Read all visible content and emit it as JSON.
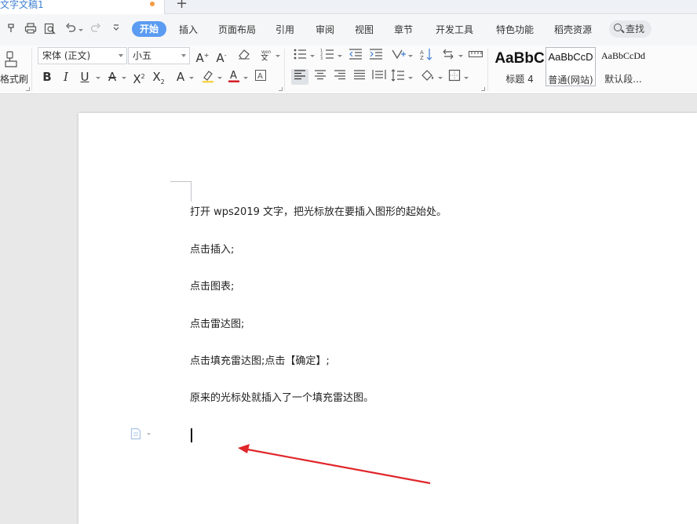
{
  "tab": {
    "title": "文字文稿1"
  },
  "menu": {
    "items": [
      "开始",
      "插入",
      "页面布局",
      "引用",
      "审阅",
      "视图",
      "章节",
      "开发工具",
      "特色功能",
      "稻壳资源"
    ],
    "active": "开始",
    "search_label": "查找"
  },
  "ribbon": {
    "format_painter_label": "格式刷",
    "font_name": "宋体 (正文)",
    "font_size": "小五",
    "styles": [
      {
        "sample": "AaBbC",
        "name": "标题 4"
      },
      {
        "sample": "AaBbCcD",
        "name": "普通(网站)"
      },
      {
        "sample": "AaBbCcDd",
        "name": "默认段..."
      }
    ]
  },
  "document": {
    "paragraphs": [
      "打开 wps2019 文字，把光标放在要插入图形的起始处。",
      "点击插入;",
      "点击图表;",
      "点击雷达图;",
      "点击填充雷达图;点击【确定】;",
      "原来的光标处就插入了一个填充雷达图。"
    ]
  },
  "colors": {
    "accent": "#5b9cf2",
    "annotation_arrow": "#e0262b",
    "tab_title": "#3f7fd1"
  },
  "icons": [
    "format-painter-icon",
    "print-icon",
    "print-preview-icon",
    "undo-icon",
    "redo-icon",
    "search-icon",
    "bold-icon",
    "italic-icon",
    "underline-icon",
    "align-left-icon",
    "paragraph-marker-icon"
  ]
}
